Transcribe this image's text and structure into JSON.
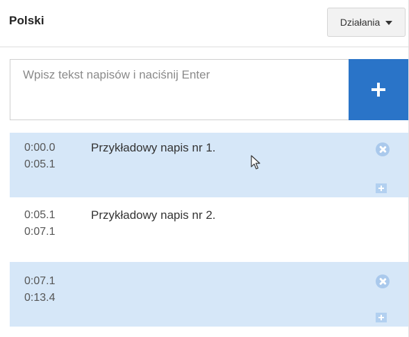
{
  "header": {
    "language": "Polski",
    "actions_label": "Działania"
  },
  "input": {
    "placeholder": "Wpisz tekst napisów i naciśnij Enter",
    "value": ""
  },
  "subtitles": [
    {
      "start": "0:00.0",
      "end": "0:05.1",
      "text": "Przykładowy napis nr 1.",
      "highlighted": true
    },
    {
      "start": "0:05.1",
      "end": "0:07.1",
      "text": "Przykładowy napis nr 2.",
      "highlighted": false
    },
    {
      "start": "0:07.1",
      "end": "0:13.4",
      "text": "",
      "highlighted": true
    }
  ],
  "colors": {
    "accent": "#2a74c8",
    "row_highlight": "#d6e7f8",
    "icon": "#aac9ec"
  },
  "icons": {
    "add": "plus-icon",
    "delete": "close-circle-icon",
    "insert": "plus-square-icon",
    "dropdown": "caret-down-icon",
    "pointer": "mouse-cursor-icon"
  }
}
